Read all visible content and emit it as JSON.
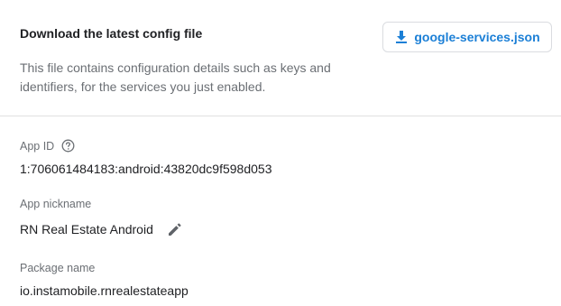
{
  "config": {
    "title": "Download the latest config file",
    "description": "This file contains configuration details such as keys and identifiers, for the services you just enabled.",
    "download_label": "google-services.json"
  },
  "fields": {
    "app_id": {
      "label": "App ID",
      "value": "1:706061484183:android:43820dc9f598d053"
    },
    "app_nickname": {
      "label": "App nickname",
      "value": "RN Real Estate Android"
    },
    "package_name": {
      "label": "Package name",
      "value": "io.instamobile.rnrealestateapp"
    }
  },
  "icons": {
    "download": "download-icon",
    "help": "help-circle-icon",
    "edit": "pencil-icon"
  },
  "colors": {
    "accent": "#1b7fd6",
    "muted_text": "#6b6f74",
    "primary_text": "#202124",
    "divider": "#e0e0e0"
  }
}
